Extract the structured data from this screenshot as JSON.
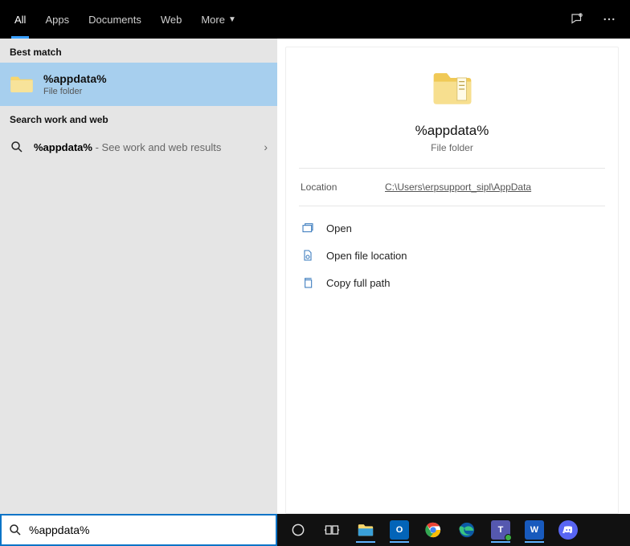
{
  "tabs": {
    "all": "All",
    "apps": "Apps",
    "documents": "Documents",
    "web": "Web",
    "more": "More"
  },
  "left": {
    "best_match": "Best match",
    "result": {
      "title": "%appdata%",
      "subtitle": "File folder"
    },
    "search_web_header": "Search work and web",
    "web": {
      "query": "%appdata%",
      "suffix": " - See work and web results"
    }
  },
  "preview": {
    "title": "%appdata%",
    "subtitle": "File folder",
    "location_label": "Location",
    "location_path": "C:\\Users\\erpsupport_sipl\\AppData",
    "actions": {
      "open": "Open",
      "open_file_location": "Open file location",
      "copy_full_path": "Copy full path"
    }
  },
  "search": {
    "value": "%appdata%"
  },
  "taskbar": {
    "items": [
      "cortana",
      "task-view",
      "file-explorer",
      "outlook",
      "chrome",
      "edge",
      "teams",
      "word",
      "discord"
    ]
  }
}
